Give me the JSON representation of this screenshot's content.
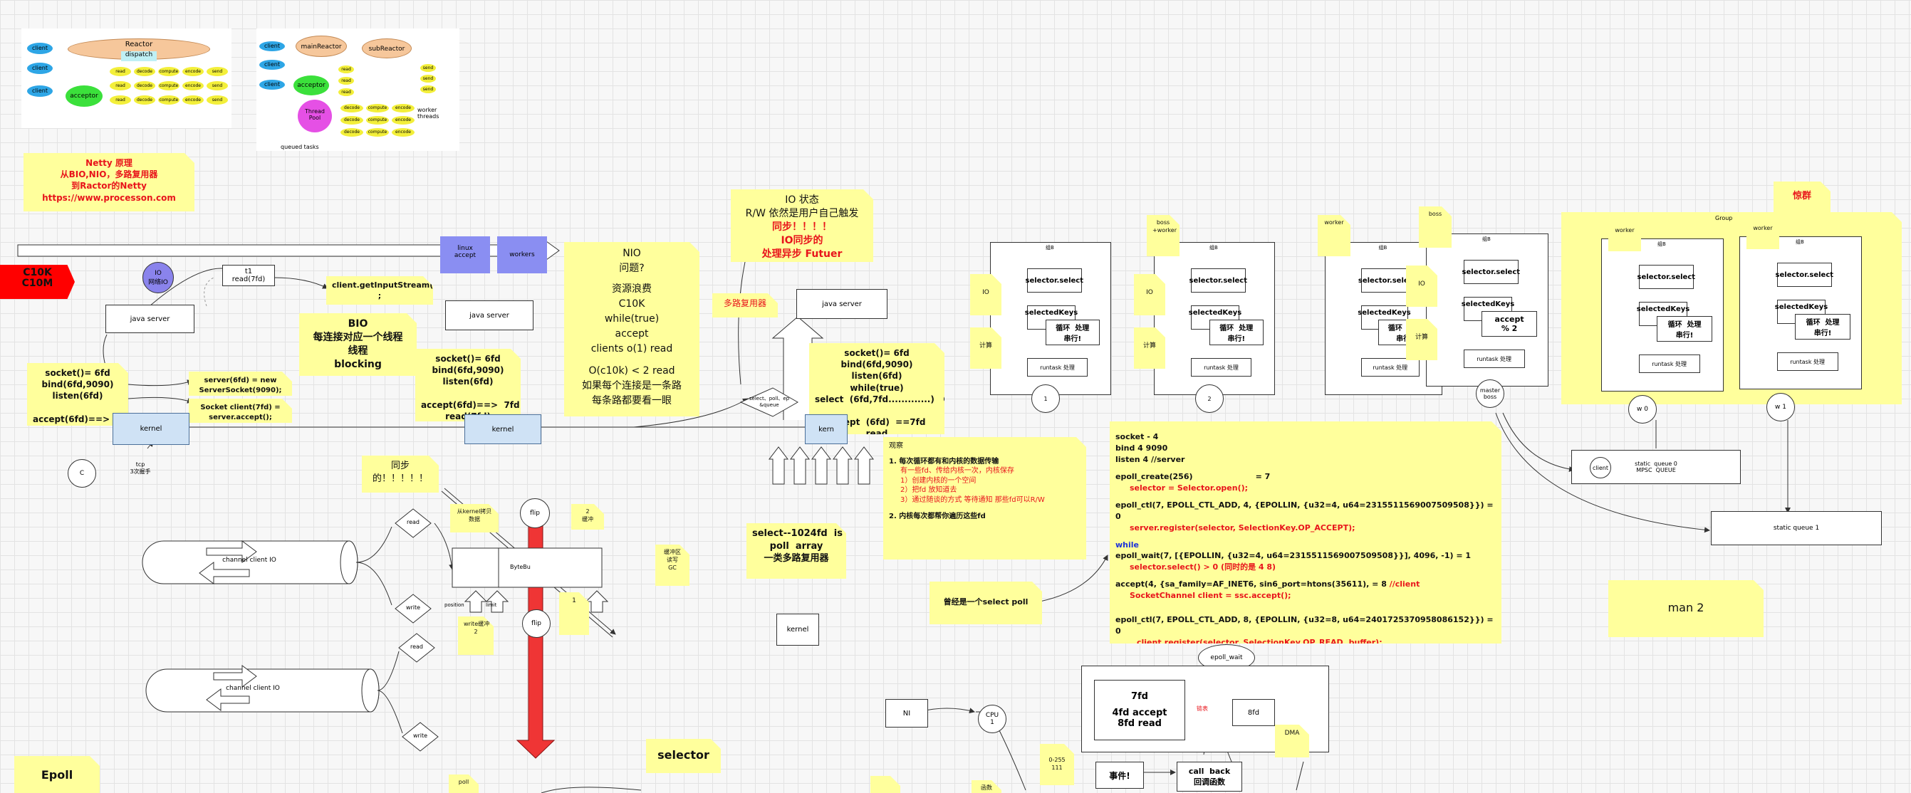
{
  "reactor1": {
    "reactor": "Reactor",
    "dispatch": "dispatch",
    "client1": "client",
    "client2": "client",
    "client3": "client",
    "acceptor": "acceptor",
    "cells": [
      "read",
      "decode",
      "compute",
      "encode",
      "send",
      "read",
      "decode",
      "compute",
      "encode",
      "send",
      "read",
      "decode",
      "compute",
      "encode",
      "send"
    ]
  },
  "reactor2": {
    "main": "mainReactor",
    "sub": "subReactor",
    "client1": "client",
    "client2": "client",
    "client3": "client",
    "acceptor": "acceptor",
    "pool": "Thread\nPool",
    "workers": "worker\nthreads",
    "queued": "queued tasks",
    "reads": [
      "read",
      "read",
      "read"
    ],
    "sends": [
      "send",
      "send",
      "send"
    ],
    "task_cells": [
      "decode",
      "compute",
      "encode",
      "decode",
      "compute",
      "encode",
      "decode",
      "compute",
      "encode"
    ]
  },
  "title_note": {
    "line1": "Netty 原理",
    "line2": "从BIO,NIO，多路复用器",
    "line3": "到Ractor的Netty",
    "line4": "https://www.processon.com"
  },
  "c10k": "C10K\nC10M",
  "io_circle": "IO\n网络IO",
  "read7fd": "t1\nread(7fd)",
  "getinput": "client.getInputStream()\n;",
  "java_server1": "java server",
  "bio_note": {
    "l1": "BIO",
    "l2": "每连接对应一个线程",
    "l3": "线程",
    "l4": "blocking"
  },
  "socket_note1": "socket()= 6fd\nbind(6fd,9090)\nlisten(6fd)\n\naccept(6fd)==> 7fd",
  "server_note": "server(6fd) = new\nServerSocket(9090);",
  "socket_client_note": "Socket client(7fd) =\nserver.accept();",
  "kernel1": "kernel",
  "c_circle": "C",
  "tcp": "tcp\n3次握手",
  "java_server2": "java server",
  "socket_note2": "socket()= 6fd\nbind(6fd,9090)\nlisten(6fd)\n\naccept(6fd)==>  7fd\nread(7fd)",
  "kernel2": "kernel",
  "linux_accept": "linux\naccept",
  "workers": "workers",
  "nio_note": {
    "l1": "NIO",
    "l2": "问题?",
    "l3": "资源浪费",
    "l4": "C10K",
    "l5": "while(true)",
    "l6": "accept",
    "l7": "clients  o(1) read",
    "l8": "O(c10k)  <  2 read",
    "l9": "如果每个连接是一条路",
    "l10": "每条路都要看一眼"
  },
  "io_state": {
    "l1": "IO 状态",
    "l2": "R/W  依然是用户自己触发",
    "l3": "同步！！！！",
    "l4": "IO同步的",
    "l5": "处理异步 Futuer"
  },
  "mux_note": "多路复用器",
  "java_server3": "java server",
  "select_diamond": "select、poll、ep\n&queue",
  "socket_note3": "socket()= 6fd\nbind(6fd,9090)\nlisten(6fd)\nwhile(true)\nselect  (6fd,7fd.............)   O(1)\n\naccept  (6fd)  ==7fd\nread",
  "kernel3": "kern",
  "sync_note": "同步\n的！！！！！",
  "channel1": "channel  client  IO",
  "channel2": "channel  client  IO",
  "read1": "read",
  "write1": "write",
  "read2": "read",
  "write2": "write",
  "small_notes": [
    "从kernel拷贝数据",
    "2\n缓冲",
    "写入\n缓冲",
    "缓冲区\n读写\nGC",
    "write缓冲\n2",
    "1"
  ],
  "buffer": "ByteBu",
  "position": "position",
  "limit": "limit",
  "flip1": "flip",
  "flip2": "flip",
  "select_note": "select--1024fd  is\npoll  array\n一类多路复用器",
  "kernel4": "kernel",
  "observe_note": {
    "title": "观察",
    "l1": "1. 每次循环都有和内核的数据传输",
    "l2": "有一些fd、传给内核一次，内核保存",
    "l3": "1）创建内核的一个空间",
    "l4": "2）把fd  放知道去",
    "l5": "3）通过随谈的方式  等待通知  那些fd可以R/W",
    "l6": "2. 内核每次都帮你遍历这些fd"
  },
  "maybe_note": "曾经是一个select  poll",
  "code": {
    "l1": "socket -  4",
    "l2": "bind   4  9090",
    "l3": "listen 4   //server",
    "l4": "epoll_create(256)                       = 7",
    "l5": "selector = Selector.open();",
    "l6": "epoll_ctl(7, EPOLL_CTL_ADD, 4, {EPOLLIN, {u32=4, u64=2315511569007509508}}) = 0",
    "l7": "server.register(selector, SelectionKey.OP_ACCEPT);",
    "l8": "while",
    "l9": "epoll_wait(7, [{EPOLLIN, {u32=4, u64=2315511569007509508}}], 4096, -1) = 1",
    "l10": "selector.select() > 0     (同时的是  4  8)",
    "l11": "accept(4, {sa_family=AF_INET6, sin6_port=htons(35611), = 8  //client",
    "l12": "SocketChannel client = ssc.accept();",
    "l13": "epoll_ctl(7, EPOLL_CTL_ADD, 8, {EPOLLIN, {u32=8, u64=2401725370958086152}}) = 0",
    "l14": "client.register(selector, SelectionKey.OP_READ, buffer);"
  },
  "groups": [
    {
      "label": "组B",
      "select": "selector.select",
      "keys": "selectedKeys",
      "proc": "循环  处理\n串行!",
      "runtask": "runtask  处理",
      "circle": "1",
      "side": [
        "IO",
        "计算"
      ]
    },
    {
      "label": "组B",
      "select": "selector.select",
      "keys": "selectedKeys",
      "proc": "循环  处理\n串行!",
      "runtask": "runtask  处理",
      "circle": "2",
      "side": [
        "IO",
        "计算"
      ],
      "top": "boss\n+worker"
    },
    {
      "label": "组B",
      "select": "selector.select",
      "keys": "selectedKeys",
      "proc": "循环  处理\n串行!",
      "runtask": "runtask  处理",
      "top": "worker"
    },
    {
      "label": "组B",
      "select": "selector.select",
      "keys": "selectedKeys",
      "proc": "accept\n% 2",
      "runtask": "runtask  处理",
      "side": [
        "IO",
        "计算"
      ],
      "top": "boss",
      "circle": "master\nboss"
    }
  ],
  "group_outer": "Group",
  "workers_right": [
    {
      "top": "worker",
      "label": "组B",
      "select": "selector.select",
      "keys": "selectedKeys",
      "proc": "循环  处理\n串行!",
      "runtask": "runtask  处理",
      "circle": "w 0"
    },
    {
      "top": "worker",
      "label": "组B",
      "select": "selector.select",
      "keys": "selectedKeys",
      "proc": "循环  处理\n串行!",
      "runtask": "runtask  处理",
      "circle": "w 1"
    }
  ],
  "alarm": "惊群",
  "queue0": "static  queue 0\nMPSC  QUEUE",
  "client_small": "client",
  "queue1": "static  queue 1",
  "man2": "man  2",
  "epoll_wait": "epoll_wait",
  "epoll_box": {
    "l1": "7fd",
    "l2": "4fd  accept",
    "l3": "8fd  read"
  },
  "dashed_label": "链表",
  "fd8": "8fd",
  "dma": "DMA",
  "nic": "NI",
  "cpu": "CPU\n1",
  "zero255": "0-255\n111",
  "event": "事件!",
  "callback": "call  back\n回调函数",
  "epoll_note": "Epoll",
  "selector_note": "selector",
  "bottom_small": [
    "poll",
    "函数"
  ]
}
